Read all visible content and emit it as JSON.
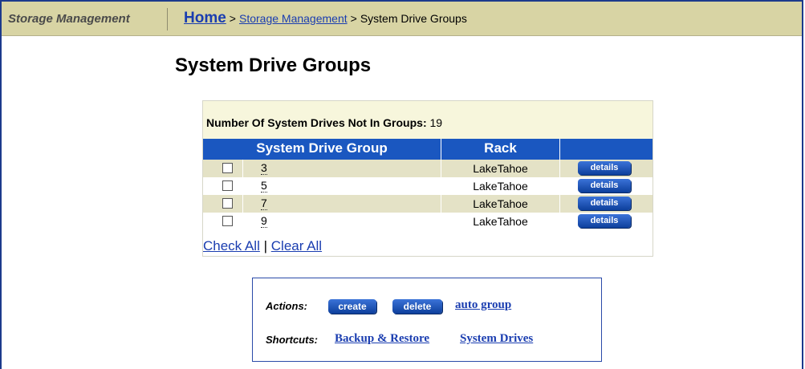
{
  "header": {
    "app_title": "Storage Management",
    "breadcrumb": {
      "home": "Home",
      "sep1": ">",
      "section": "Storage Management",
      "sep2": ">",
      "current": "System Drive Groups"
    }
  },
  "page_title": "System Drive Groups",
  "summary": {
    "label": "Number Of System Drives Not In Groups:",
    "value": "19"
  },
  "table": {
    "columns": [
      "System Drive Group",
      "Rack",
      ""
    ],
    "rows": [
      {
        "group": "3",
        "rack": "LakeTahoe",
        "action": "details",
        "checked": false
      },
      {
        "group": "5",
        "rack": "LakeTahoe",
        "action": "details",
        "checked": false
      },
      {
        "group": "7",
        "rack": "LakeTahoe",
        "action": "details",
        "checked": false
      },
      {
        "group": "9",
        "rack": "LakeTahoe",
        "action": "details",
        "checked": false
      }
    ]
  },
  "selection": {
    "check_all": "Check All",
    "divider": "|",
    "clear_all": "Clear All"
  },
  "actions": {
    "label": "Actions:",
    "create": "create",
    "delete": "delete",
    "auto_group": "auto group"
  },
  "shortcuts": {
    "label": "Shortcuts:",
    "backup_restore": "Backup & Restore",
    "system_drives": "System Drives"
  },
  "colors": {
    "header_bar": "#d8d4a4",
    "table_header": "#1a57c0",
    "alt_row": "#e4e2c6",
    "summary_bg": "#f7f6dc",
    "link": "#1a3db0"
  }
}
